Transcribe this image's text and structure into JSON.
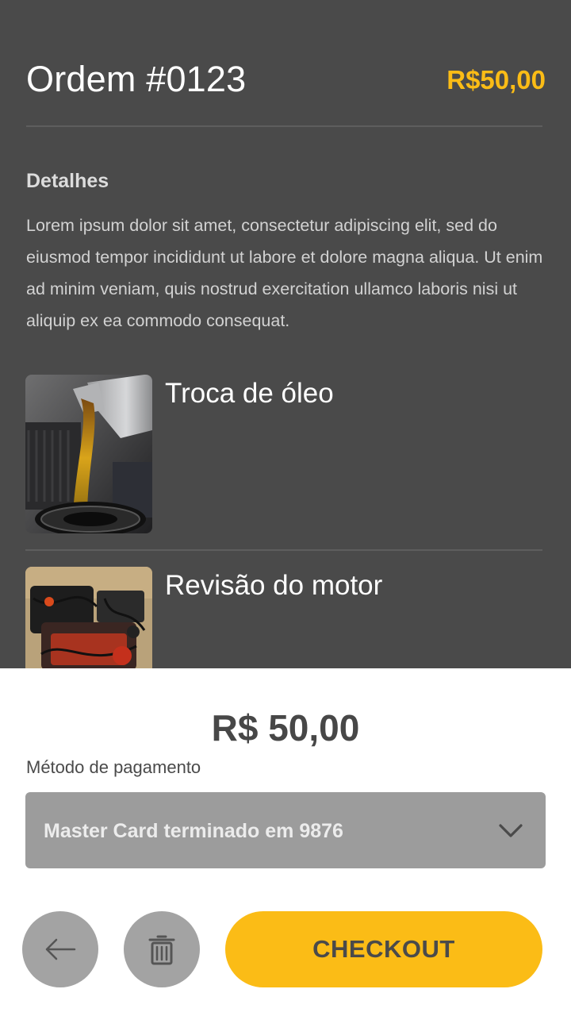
{
  "order": {
    "title": "Ordem #0123",
    "price": "R$50,00"
  },
  "details": {
    "title": "Detalhes",
    "text": "Lorem ipsum dolor sit amet, consectetur adipiscing elit, sed do eiusmod tempor incididunt ut labore et dolore magna aliqua. Ut enim ad minim veniam, quis nostrud exercitation ullamco laboris nisi ut aliquip ex ea commodo consequat."
  },
  "services": [
    {
      "name": "Troca de óleo"
    },
    {
      "name": "Revisão do motor"
    }
  ],
  "payment": {
    "total": "R$ 50,00",
    "method_label": "Método de pagamento",
    "selected_method": "Master Card terminado em 9876"
  },
  "actions": {
    "back_icon": "arrow-left-icon",
    "delete_icon": "trash-icon",
    "checkout_label": "CHECKOUT"
  },
  "colors": {
    "background": "#4a4a4a",
    "accent": "#fbbc16",
    "sheet": "#ffffff",
    "select": "#9c9c9c",
    "button_gray": "#a3a3a3"
  }
}
